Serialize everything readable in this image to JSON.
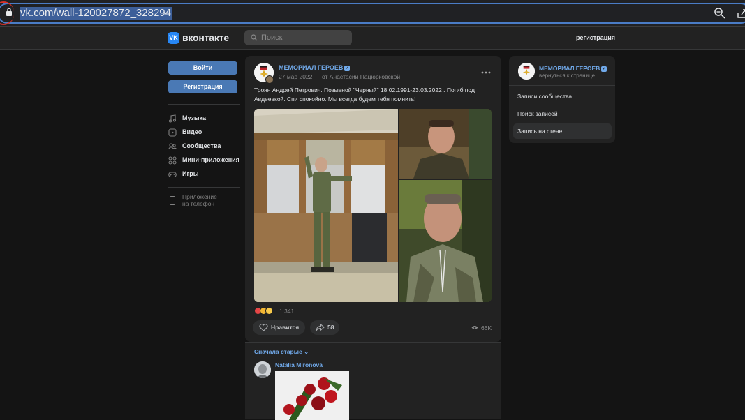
{
  "browser": {
    "url": "vk.com/wall-120027872_328294"
  },
  "header": {
    "logo_text": "вконтакте",
    "search_placeholder": "Поиск",
    "register_link": "регистрация"
  },
  "sidebar": {
    "login_button": "Войти",
    "register_button": "Регистрация",
    "items": [
      {
        "label": "Музыка",
        "icon": "music-icon"
      },
      {
        "label": "Видео",
        "icon": "video-icon"
      },
      {
        "label": "Сообщества",
        "icon": "communities-icon"
      },
      {
        "label": "Мини-приложения",
        "icon": "mini-apps-icon"
      },
      {
        "label": "Игры",
        "icon": "games-icon"
      }
    ],
    "app_promo": {
      "line1": "Приложение",
      "line2": "на телефон"
    }
  },
  "post": {
    "author": "МЕМОРИАЛ ГЕРОЕВ",
    "date": "27 мар 2022",
    "separator": "·",
    "from": "от Анастасии Пацюрковской",
    "text": "Троян Андрей Петрович. Позывной \"Черный\" 18.02.1991-23.03.2022 . Погиб под Авдеевкой. Спи спокойно. Мы всегда будем тебя помнить!",
    "reactions_count": "1 341",
    "like_label": "Нравится",
    "share_count": "58",
    "views": "66K"
  },
  "comments": {
    "sort_label": "Сначала старые",
    "items": [
      {
        "author": "Natalia Mironova"
      }
    ]
  },
  "right_panel": {
    "title": "МЕМОРИАЛ ГЕРОЕВ",
    "subtitle": "вернуться к странице",
    "items": [
      {
        "label": "Записи сообщества",
        "active": false
      },
      {
        "label": "Поиск записей",
        "active": false
      },
      {
        "label": "Запись на стене",
        "active": true
      }
    ]
  },
  "colors": {
    "accent": "#71aaeb",
    "button": "#4a79b5",
    "card": "#222222",
    "background": "#141414"
  }
}
